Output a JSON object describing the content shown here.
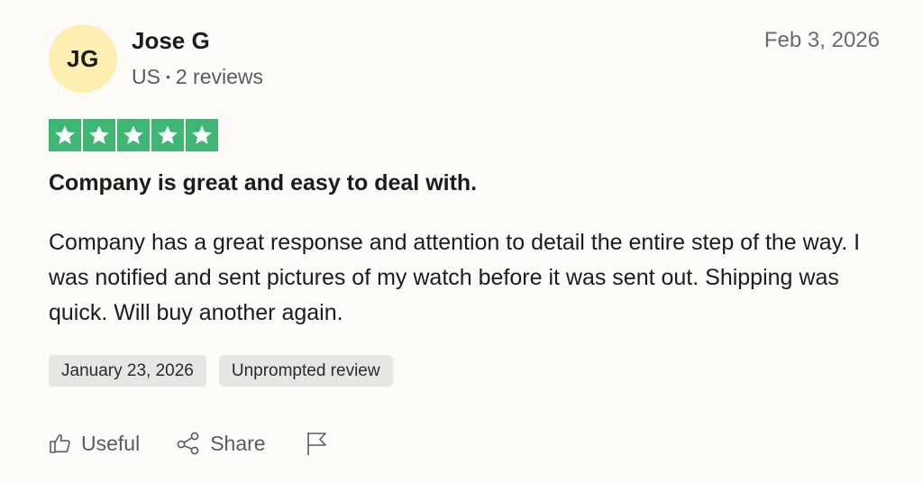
{
  "reviewer": {
    "initials": "JG",
    "name": "Jose G",
    "country": "US",
    "separator": "•",
    "review_count": "2 reviews",
    "avatar_color": "#fcefb1"
  },
  "review": {
    "posted_date": "Feb 3, 2026",
    "rating": 5,
    "rating_max": 5,
    "star_color": "#3fb673",
    "title": "Company is great and easy to deal with.",
    "body": "Company has a great response and attention to detail the entire step of the way. I was notified and sent pictures of my watch before it was sent out. Shipping was quick. Will buy another again.",
    "tags": [
      "January 23, 2026",
      "Unprompted review"
    ]
  },
  "actions": {
    "useful_label": "Useful",
    "share_label": "Share",
    "useful_icon": "thumbs-up-icon",
    "share_icon": "share-icon",
    "flag_icon": "flag-icon"
  }
}
